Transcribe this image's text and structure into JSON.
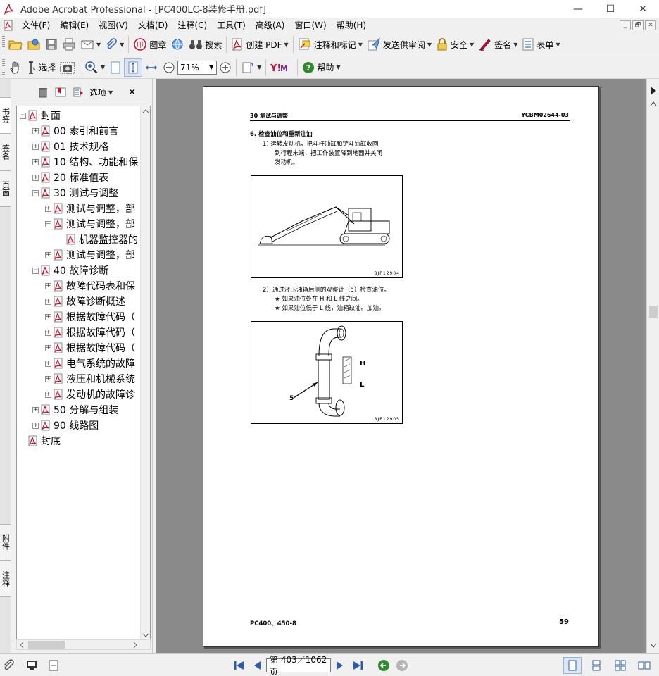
{
  "window": {
    "title": "Adobe Acrobat Professional - [PC400LC-8装修手册.pdf]",
    "controls": {
      "minimize": "—",
      "maximize": "☐",
      "close": "✕"
    }
  },
  "menubar": {
    "items": [
      "文件(F)",
      "编辑(E)",
      "视图(V)",
      "文档(D)",
      "注释(C)",
      "工具(T)",
      "高级(A)",
      "窗口(W)",
      "帮助(H)"
    ],
    "mdi": [
      "_",
      "🗗",
      "✕"
    ]
  },
  "toolbar1": {
    "stamp": "图章",
    "search": "搜索",
    "create_pdf": "创建 PDF",
    "comment_markup": "注释和标记",
    "send_review": "发送供审阅",
    "security": "安全",
    "sign": "签名",
    "forms": "表单"
  },
  "toolbar2": {
    "select": "选择",
    "zoom_value": "71%",
    "help": "帮助"
  },
  "side_tabs": {
    "bookmarks": "书签",
    "signatures": "签名",
    "pages": "页面",
    "attachments": "附件",
    "comments": "注释"
  },
  "bookmark_panel": {
    "options": "选项",
    "close": "✕",
    "items": [
      {
        "label": "封面",
        "level": 0,
        "expander": "−"
      },
      {
        "label": "00 索引和前言",
        "level": 1,
        "expander": "+"
      },
      {
        "label": "01 技术规格",
        "level": 1,
        "expander": "+"
      },
      {
        "label": "10 结构、功能和保",
        "level": 1,
        "expander": "+"
      },
      {
        "label": "20 标准值表",
        "level": 1,
        "expander": "+"
      },
      {
        "label": "30 测试与调整",
        "level": 1,
        "expander": "−"
      },
      {
        "label": "测试与调整，部",
        "level": 2,
        "expander": "+"
      },
      {
        "label": "测试与调整，部",
        "level": 2,
        "expander": "−"
      },
      {
        "label": "机器监控器的",
        "level": 3,
        "expander": ""
      },
      {
        "label": "测试与调整，部",
        "level": 2,
        "expander": "+"
      },
      {
        "label": "40 故障诊断",
        "level": 1,
        "expander": "−"
      },
      {
        "label": "故障代码表和保",
        "level": 2,
        "expander": "+"
      },
      {
        "label": "故障诊断概述",
        "level": 2,
        "expander": "+"
      },
      {
        "label": "根据故障代码（",
        "level": 2,
        "expander": "+"
      },
      {
        "label": "根据故障代码（",
        "level": 2,
        "expander": "+"
      },
      {
        "label": "根据故障代码（",
        "level": 2,
        "expander": "+"
      },
      {
        "label": "电气系统的故障",
        "level": 2,
        "expander": "+"
      },
      {
        "label": "液压和机械系统",
        "level": 2,
        "expander": "+"
      },
      {
        "label": "发动机的故障诊",
        "level": 2,
        "expander": "+"
      },
      {
        "label": "50 分解与组装",
        "level": 1,
        "expander": "+"
      },
      {
        "label": "90 线路图",
        "level": 1,
        "expander": "+"
      },
      {
        "label": "封底",
        "level": 0,
        "expander": ""
      }
    ]
  },
  "pdf_page": {
    "header_left": "30 测试与调整",
    "header_right": "YCBM02644-03",
    "section_title": "6.  检查油位和重新注油",
    "step1": [
      "1)   运转发动机，把斗杆油缸和铲斗油缸收回",
      "到行程末端，把工作装置降到地面并关闭",
      "发动机。"
    ],
    "fig1_caption": "BJP12904",
    "step2": "2）通过液压油箱后侧的观察计（5）检查油位。",
    "bullet1": "★  如果油位处在 H 和 L 线之间。",
    "bullet2": "★  如果油位低于 L 线，油箱缺油。加油。",
    "fig2_caption": "BJP12905",
    "fig2_label_h": "H",
    "fig2_label_l": "L",
    "fig2_label_5": "5",
    "footer_left": "PC400、450-8",
    "footer_right": "59"
  },
  "statusbar": {
    "page_display": "第 403／1062 页"
  },
  "colors": {
    "pdf_red": "#c8102e",
    "doc_bg": "#8a8a8a",
    "nav_blue": "#2a5db0",
    "green": "#2f8a2f"
  }
}
